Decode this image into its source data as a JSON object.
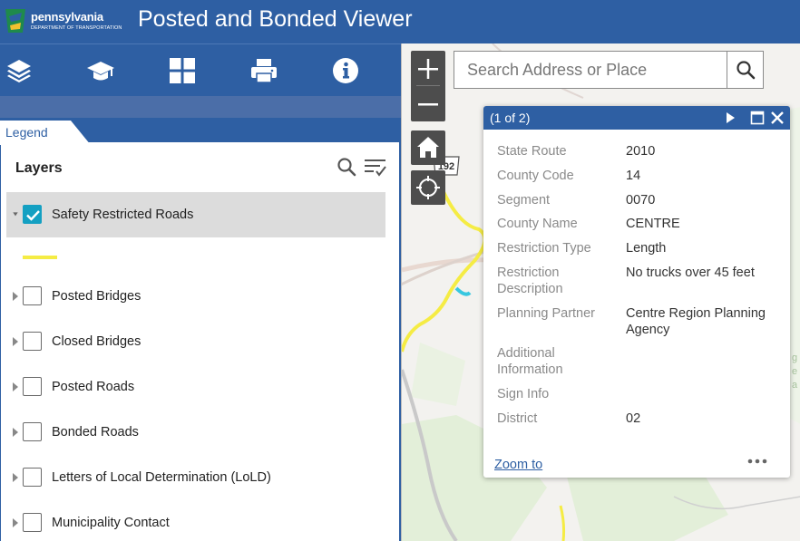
{
  "header": {
    "logo_name": "pennsylvania",
    "logo_sub": "DEPARTMENT OF TRANSPORTATION",
    "title": "Posted and Bonded Viewer"
  },
  "toolbar": {
    "icons": [
      "layers-icon",
      "graduation-cap-icon",
      "grid-icon",
      "print-icon",
      "info-icon"
    ]
  },
  "panel": {
    "tab_label": "Legend",
    "layers_title": "Layers",
    "layers": [
      {
        "label": "Safety Restricted Roads",
        "checked": true,
        "expanded": true
      },
      {
        "label": "Posted Bridges",
        "checked": false,
        "expanded": false
      },
      {
        "label": "Closed Bridges",
        "checked": false,
        "expanded": false
      },
      {
        "label": "Posted Roads",
        "checked": false,
        "expanded": false
      },
      {
        "label": "Bonded Roads",
        "checked": false,
        "expanded": false
      },
      {
        "label": "Letters of Local Determination (LoLD)",
        "checked": false,
        "expanded": false
      },
      {
        "label": "Municipality Contact",
        "checked": false,
        "expanded": false
      }
    ],
    "legend_color": "#f5ec44"
  },
  "map": {
    "search_placeholder": "Search Address or Place",
    "route_shield": "192"
  },
  "popup": {
    "count": "(1 of 2)",
    "fields": [
      {
        "name": "State Route",
        "value": "2010"
      },
      {
        "name": "County Code",
        "value": "14"
      },
      {
        "name": "Segment",
        "value": "0070"
      },
      {
        "name": "County Name",
        "value": "CENTRE"
      },
      {
        "name": "Restriction Type",
        "value": "Length"
      },
      {
        "name": "Restriction Description",
        "value": "No trucks over 45 feet"
      },
      {
        "name": "Planning Partner",
        "value": "Centre Region Planning Agency"
      },
      {
        "name": "Additional Information",
        "value": ""
      },
      {
        "name": "Sign Info",
        "value": ""
      },
      {
        "name": "District",
        "value": "02"
      }
    ],
    "zoom_label": "Zoom to"
  },
  "colors": {
    "brand_blue": "#2e5fa3",
    "check_teal": "#14a0c2",
    "restricted_road": "#f5ec44"
  }
}
